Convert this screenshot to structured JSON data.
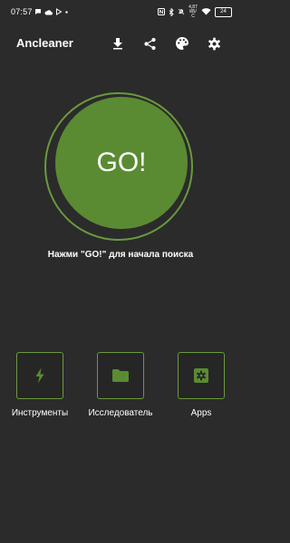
{
  "status_bar": {
    "time": "07:57",
    "net_speed_value": "4,87",
    "net_speed_unit": "КБ/С",
    "battery": "24"
  },
  "app_bar": {
    "title": "Ancleaner",
    "actions": [
      "download-icon",
      "share-icon",
      "palette-icon",
      "settings-icon"
    ]
  },
  "main": {
    "go_label": "GO!",
    "hint": "Нажми \"GO!\" для начала поиска"
  },
  "tools": [
    {
      "label": "Инструменты",
      "icon": "bolt-icon"
    },
    {
      "label": "Исследователь",
      "icon": "folder-icon"
    },
    {
      "label": "Apps",
      "icon": "gear-icon"
    }
  ],
  "colors": {
    "background": "#2b2b2b",
    "accent": "#5a8b32",
    "accent_border": "#6a9a3e"
  }
}
